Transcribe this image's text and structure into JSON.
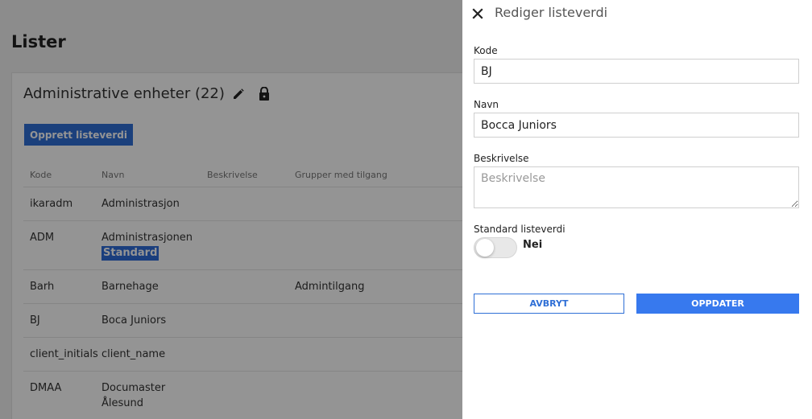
{
  "page": {
    "title": "Lister"
  },
  "card": {
    "title": "Administrative enheter (22)",
    "create_button": "Opprett listeverdi"
  },
  "table": {
    "headers": {
      "kode": "Kode",
      "navn": "Navn",
      "beskrivelse": "Beskrivelse",
      "grupper": "Grupper med tilgang"
    },
    "rows": [
      {
        "kode": "ikaradm",
        "navn": "Administrasjon",
        "beskrivelse": "",
        "grupper": ""
      },
      {
        "kode": "ADM",
        "navn": "Administrasjonen",
        "badge": "Standard",
        "beskrivelse": "",
        "grupper": ""
      },
      {
        "kode": "Barh",
        "navn": "Barnehage",
        "beskrivelse": "",
        "grupper": "Admintilgang"
      },
      {
        "kode": "BJ",
        "navn": "Boca Juniors",
        "beskrivelse": "",
        "grupper": ""
      },
      {
        "kode": "client_initials",
        "navn": "client_name",
        "beskrivelse": "",
        "grupper": ""
      },
      {
        "kode": "DMAA",
        "navn": "Documaster",
        "navn2": "Ålesund",
        "beskrivelse": "",
        "grupper": ""
      }
    ]
  },
  "panel": {
    "title": "Rediger listeverdi",
    "kode_label": "Kode",
    "kode_value": "BJ",
    "navn_label": "Navn",
    "navn_value": "Bocca Juniors",
    "beskrivelse_label": "Beskrivelse",
    "beskrivelse_placeholder": "Beskrivelse",
    "standard_label": "Standard listeverdi",
    "standard_value": "Nei",
    "cancel_button": "AVBRYT",
    "update_button": "OPPDATER"
  },
  "colors": {
    "primary": "#2f6fd6",
    "update": "#3779ee",
    "badge": "#2d6bd8"
  },
  "icons": {
    "edit": "pencil-icon",
    "lock": "lock-icon",
    "close": "close-icon"
  }
}
